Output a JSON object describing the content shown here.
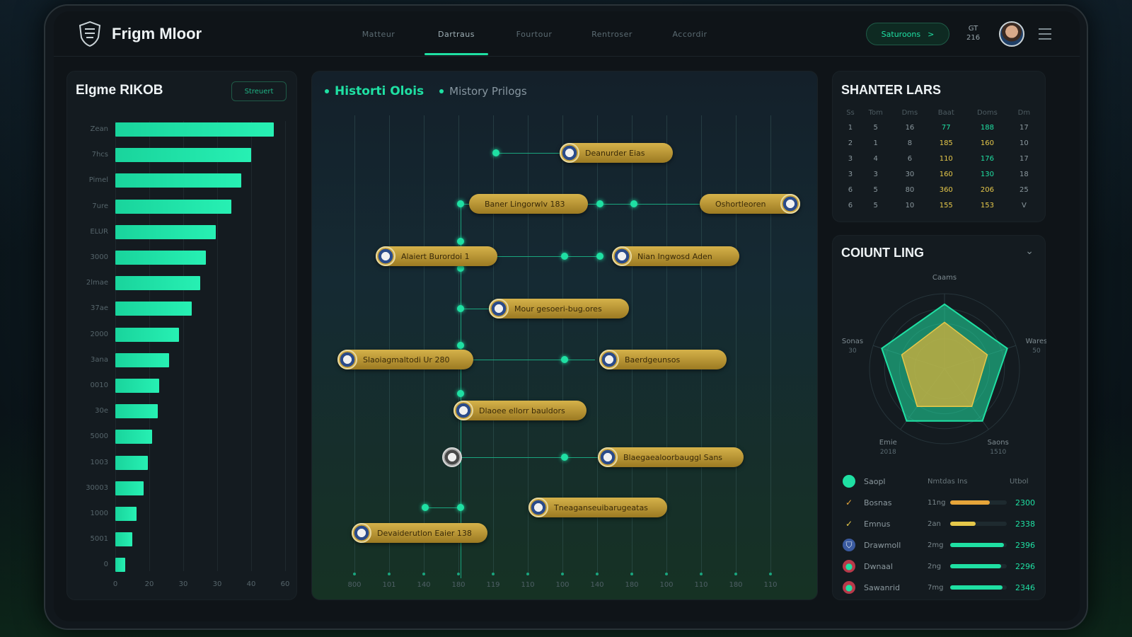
{
  "app": {
    "title": "Frigm Mloor"
  },
  "nav": {
    "tabs": [
      "Matteur",
      "Dartraus",
      "Fourtour",
      "Rentroser",
      "Accordir"
    ],
    "active": 1
  },
  "header": {
    "action_label": "Saturoons",
    "action_arrow": ">",
    "tiny_top": "GT",
    "tiny_bottom": "216"
  },
  "left_panel": {
    "title": "Elgme RIKOB",
    "button_label": "Streuert",
    "chart_data": {
      "type": "bar",
      "orientation": "horizontal",
      "categories": [
        "Zean",
        "7hcs",
        "Pimel",
        "7ure",
        "ELUR",
        "3000",
        "2lmae",
        "37ae",
        "2000",
        "3ana",
        "0010",
        "30e",
        "5000",
        "1003",
        "30003",
        "1000",
        "5001",
        "0"
      ],
      "values": [
        56,
        48,
        44.5,
        41,
        35.5,
        32,
        30,
        27,
        22.5,
        19,
        15.5,
        15,
        13,
        11.5,
        10,
        7.5,
        6,
        3.5
      ],
      "x_ticks": [
        "0",
        "20",
        "30",
        "30",
        "40",
        "60"
      ],
      "xlim": [
        0,
        60
      ]
    }
  },
  "timeline": {
    "legend_primary": "Historti Olois",
    "legend_secondary": "Mistory Prilogs",
    "events": [
      {
        "label": "Deanurder Eias"
      },
      {
        "label": "Baner Lingorwlv 183"
      },
      {
        "label": "Oshortleoren"
      },
      {
        "label": "Alaiert Burordoi 1"
      },
      {
        "label": "Nian Ingwosd Aden"
      },
      {
        "label": "Mour gesoeri-bug.ores"
      },
      {
        "label": "Slaoiagmaltodi Ur 280"
      },
      {
        "label": "Baerdgeunsos"
      },
      {
        "label": "Dlaoee ellorr bauldors"
      },
      {
        "label": "Blaegaealoorbauggl Sans"
      },
      {
        "label": "Tneaganseuibarugeatas"
      },
      {
        "label": "Devaiderutlon Eaier 138"
      }
    ],
    "x_ticks": [
      "800",
      "101",
      "140",
      "180",
      "119",
      "110",
      "100",
      "140",
      "180",
      "100",
      "110",
      "180",
      "110"
    ]
  },
  "shooter_table": {
    "title": "SHANTER LARS",
    "columns": [
      "Ss",
      "Tom",
      "Dms",
      "Baat",
      "Doms",
      "Dm"
    ],
    "rows": [
      [
        "1",
        "5",
        "16",
        "77",
        "188",
        "17"
      ],
      [
        "2",
        "1",
        "8",
        "185",
        "160",
        "10"
      ],
      [
        "3",
        "4",
        "6",
        "110",
        "176",
        "17"
      ],
      [
        "3",
        "3",
        "30",
        "160",
        "130",
        "18"
      ],
      [
        "6",
        "5",
        "80",
        "360",
        "206",
        "25"
      ],
      [
        "6",
        "5",
        "10",
        "155",
        "153",
        "V"
      ]
    ]
  },
  "count_panel": {
    "title": "COIUNT LING",
    "radar": {
      "axes": [
        {
          "label": "Caams",
          "sub": ""
        },
        {
          "label": "Wares",
          "sub": "50"
        },
        {
          "label": "Saons",
          "sub": "1510"
        },
        {
          "label": "Emie",
          "sub": "2018"
        },
        {
          "label": "Sonas",
          "sub": "30"
        }
      ],
      "outer": [
        0.86,
        0.88,
        0.86,
        0.86,
        0.88
      ],
      "inner": [
        0.62,
        0.6,
        0.62,
        0.62,
        0.6
      ]
    },
    "stats_header": {
      "left": "Nmtdas Ins",
      "right": "Utbol"
    },
    "stats": [
      {
        "name": "Saopl",
        "val": "",
        "pct": 0,
        "num": "",
        "icon": "ball-icon",
        "color": "#1fe0a3"
      },
      {
        "name": "Bosnas",
        "val": "11ng",
        "pct": 0.7,
        "num": "2300",
        "icon": "check-icon",
        "color": "#e6a53a"
      },
      {
        "name": "Emnus",
        "val": "2an",
        "pct": 0.45,
        "num": "2338",
        "icon": "swoosh-icon",
        "color": "#e6c84a"
      },
      {
        "name": "Drawmoll",
        "val": "2mg",
        "pct": 0.95,
        "num": "2396",
        "icon": "shield-icon",
        "color": "#1fe0a3"
      },
      {
        "name": "Dwnaal",
        "val": "2ng",
        "pct": 0.9,
        "num": "2296",
        "icon": "badge-icon",
        "color": "#1fe0a3"
      },
      {
        "name": "Sawanrid",
        "val": "7mg",
        "pct": 0.93,
        "num": "2346",
        "icon": "crest-icon",
        "color": "#1fe0a3"
      }
    ]
  }
}
